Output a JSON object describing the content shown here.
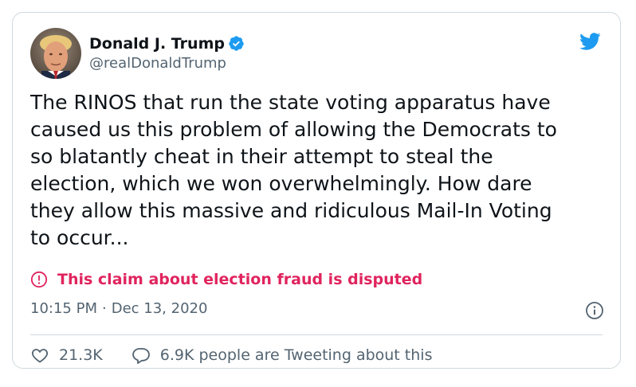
{
  "tweet": {
    "author": {
      "display_name": "Donald J. Trump",
      "handle": "@realDonaldTrump",
      "verified": true,
      "avatar_icon": "avatar"
    },
    "platform_icon": "twitter-bird-icon",
    "text": "The RINOS that run the state voting apparatus have\ncaused us this problem of allowing the Democrats to\nso blatantly cheat in their attempt to steal the\nelection, which we won overwhelmingly. How dare\nthey allow this massive and ridiculous Mail-In Voting\nto occur...",
    "disputed_notice": "This claim about election fraud is disputed",
    "time": "10:15 PM",
    "separator": "·",
    "date": "Dec 13, 2020",
    "likes": "21.3K",
    "conversation": "6.9K people are Tweeting about this"
  },
  "colors": {
    "brand_blue": "#1d9bf0",
    "warning_red": "#e0245e",
    "secondary_text": "#536471",
    "border": "#cfd9de"
  }
}
